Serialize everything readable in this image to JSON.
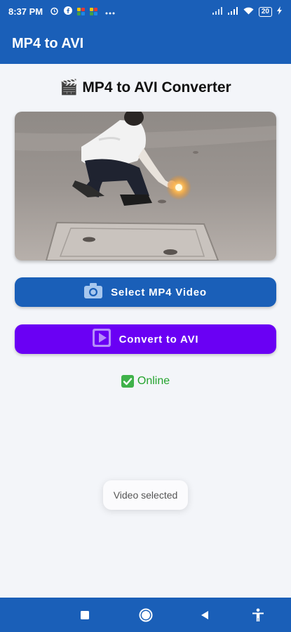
{
  "status_bar": {
    "time": "8:37 PM",
    "left_icons": [
      "alarm-icon",
      "facebook-icon",
      "pinwheel-icon",
      "pinwheel-icon",
      "more-icon"
    ],
    "battery": "20",
    "right_icons": [
      "signal-icon",
      "signal-icon",
      "wifi-icon",
      "battery-icon",
      "charging-icon"
    ]
  },
  "app_bar": {
    "title": "MP4 to AVI"
  },
  "main": {
    "title_emoji": "🎬",
    "title": "MP4 to AVI Converter",
    "select_button": {
      "label": "Select MP4 Video",
      "icon": "camera-icon"
    },
    "convert_button": {
      "label": "Convert to AVI",
      "icon": "play-icon"
    },
    "status_text": "Online",
    "status_icon": "check-icon"
  },
  "toast": {
    "text": "Video selected"
  },
  "nav_bar": {
    "buttons": [
      "recents-button",
      "home-button",
      "back-button",
      "accessibility-button"
    ]
  },
  "colors": {
    "primary": "#1a5fb8",
    "accent": "#6a00f4",
    "success": "#23a32d",
    "background": "#f3f5f9"
  }
}
